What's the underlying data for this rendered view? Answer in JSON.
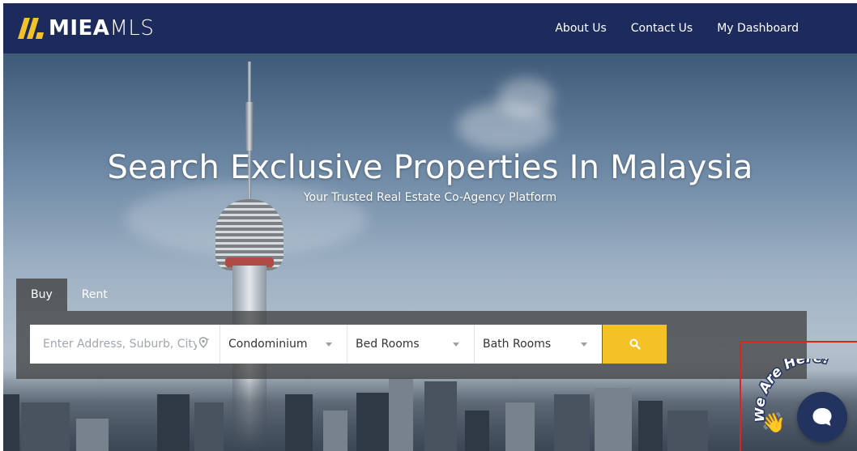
{
  "brand": {
    "logo_strong": "MIEA",
    "logo_light": "MLS",
    "accent_color": "#f2c227",
    "nav_bg": "#1c2a5c"
  },
  "nav": {
    "links": [
      "About Us",
      "Contact Us",
      "My Dashboard"
    ]
  },
  "hero": {
    "title": "Search Exclusive Properties In Malaysia",
    "subtitle": "Your Trusted Real Estate Co-Agency Platform"
  },
  "search": {
    "tabs": [
      {
        "label": "Buy",
        "active": true
      },
      {
        "label": "Rent",
        "active": false
      }
    ],
    "address_placeholder": "Enter Address, Suburb, City",
    "property_type": "Condominium",
    "bedrooms": "Bed Rooms",
    "bathrooms": "Bath Rooms",
    "search_icon": "search-icon"
  },
  "chat_widget": {
    "badge_text": "We Are Here!",
    "wave_emoji": "👋",
    "icon": "chat-bubble-icon"
  }
}
